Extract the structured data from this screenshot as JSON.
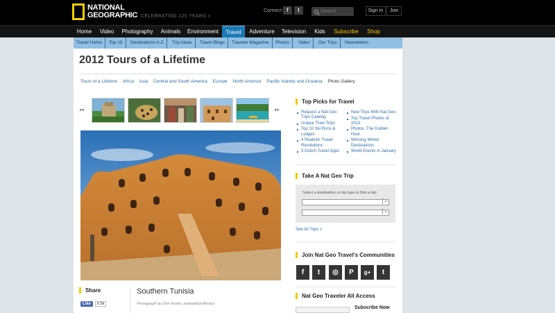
{
  "header": {
    "logo_line1": "NATIONAL",
    "logo_line2": "GEOGRAPHIC",
    "tagline": "CELEBRATING 125 YEARS »",
    "connect_label": "Connect:",
    "facebook_glyph": "f",
    "twitter_glyph": "t",
    "search_placeholder": "Search",
    "signin_label": "Sign In",
    "join_label": "Join"
  },
  "main_nav": [
    {
      "label": "Home"
    },
    {
      "label": "Video"
    },
    {
      "label": "Photography"
    },
    {
      "label": "Animals"
    },
    {
      "label": "Environment"
    },
    {
      "label": "Travel",
      "active": true
    },
    {
      "label": "Adventure"
    },
    {
      "label": "Television"
    },
    {
      "label": "Kids"
    },
    {
      "label": "Subscribe",
      "highlight": true
    },
    {
      "label": "Shop",
      "highlight": true
    }
  ],
  "sub_nav": [
    "Travel Home",
    "Top 10",
    "Destinations A-Z",
    "Trip Ideas",
    "Travel Blogs",
    "Traveler Magazine",
    "Photos",
    "Video",
    "Our Trips",
    "Newsletters"
  ],
  "page": {
    "title": "2012 Tours of a Lifetime",
    "categories": [
      "Tours of a Lifetime",
      "Africa",
      "Asia",
      "Central and South America",
      "Europe",
      "North America",
      "Pacific Islands and Oceania",
      "Photo Gallery"
    ],
    "strip_prev": "◂◂",
    "strip_next": "▸▸",
    "photo_title": "Southern Tunisia",
    "photo_credit": "Photograph by Dirk Panier, arabianEye/Redux"
  },
  "share": {
    "heading": "Share",
    "like_label": "Like",
    "like_count": "6.5k"
  },
  "sidebar": {
    "top_picks": {
      "heading": "Top Picks for Travel",
      "col1": [
        "Request a Nat Geo Trips Catalog",
        "Unique Train Trips",
        "Top 10 Ski Runs & Lodges",
        "4 Realistic Travel Resolutions",
        "3 Clutch Travel Apps"
      ],
      "col2": [
        "New Trips With Nat Geo",
        "Top Travel Photos of 2013",
        "Photos: The Golden Hour",
        "Winning Winter Destinations",
        "World Events in January"
      ]
    },
    "trip": {
      "heading": "Take A Nat Geo Trip",
      "prompt": "Select a destination or trip type to find a trip:",
      "see_all": "See All Trips »"
    },
    "communities": {
      "heading": "Join Nat Geo Travel's Communities",
      "icons": [
        {
          "name": "facebook-icon",
          "glyph": "f"
        },
        {
          "name": "twitter-icon",
          "glyph": "t"
        },
        {
          "name": "instagram-icon",
          "glyph": "◎"
        },
        {
          "name": "pinterest-icon",
          "glyph": "P"
        },
        {
          "name": "googleplus-icon",
          "glyph": "g+"
        },
        {
          "name": "tumblr-icon",
          "glyph": "t"
        }
      ]
    },
    "all_access": {
      "heading": "Nat Geo Traveler All Access",
      "subscribe_label": "Subscribe Now"
    }
  },
  "colors": {
    "brand_yellow": "#f7c600",
    "active_tab": "#1c7ab6",
    "link": "#2b6ea6"
  }
}
